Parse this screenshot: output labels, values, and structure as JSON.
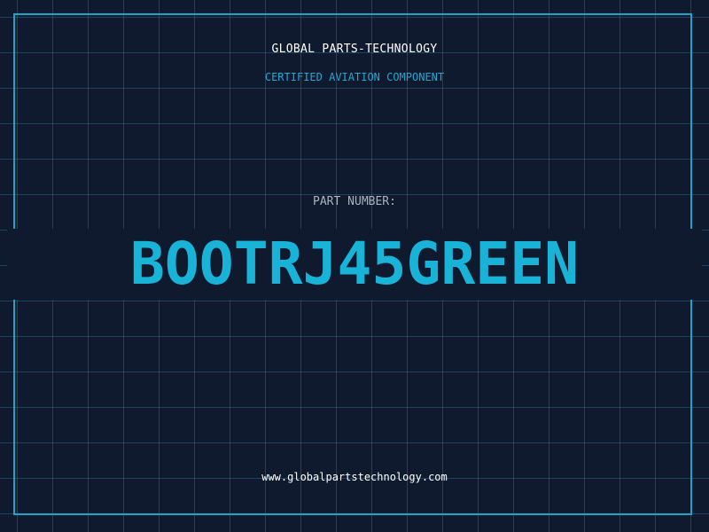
{
  "header": {
    "company": "GLOBAL PARTS-TECHNOLOGY",
    "subtitle": "CERTIFIED AVIATION COMPONENT"
  },
  "part": {
    "label": "PART NUMBER:",
    "number": "BOOTRJ45GREEN"
  },
  "footer": {
    "url": "www.globalpartstechnology.com"
  },
  "colors": {
    "background": "#101a2e",
    "grid": "#22789f",
    "accent": "#1ab3d8",
    "frame": "#1ba6c9",
    "label": "#a8b3c4",
    "text": "#ffffff"
  }
}
